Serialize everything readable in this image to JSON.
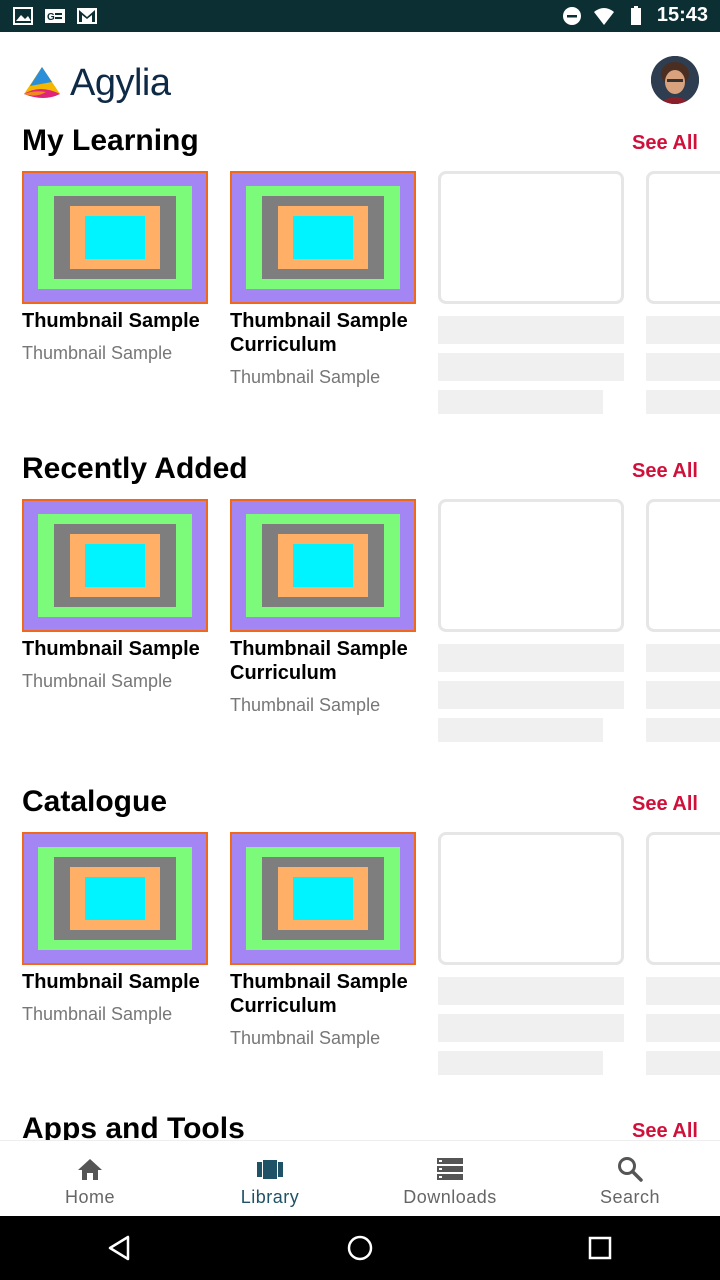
{
  "status_bar": {
    "time": "15:43",
    "left_icons": [
      "image-icon",
      "news-icon",
      "gmail-icon"
    ],
    "right_icons": [
      "do-not-disturb-icon",
      "wifi-icon",
      "battery-icon"
    ]
  },
  "header": {
    "app_name": "Agylia"
  },
  "sections": [
    {
      "title": "My Learning",
      "see_all": "See All",
      "cards": [
        {
          "title": "Thumbnail Sample",
          "subtitle": "Thumbnail Sample"
        },
        {
          "title": "Thumbnail Sample Curriculum",
          "subtitle": "Thumbnail Sample"
        }
      ]
    },
    {
      "title": "Recently Added",
      "see_all": "See All",
      "cards": [
        {
          "title": "Thumbnail Sample",
          "subtitle": "Thumbnail Sample"
        },
        {
          "title": "Thumbnail Sample Curriculum",
          "subtitle": "Thumbnail Sample"
        }
      ]
    },
    {
      "title": "Catalogue",
      "see_all": "See All",
      "cards": [
        {
          "title": "Thumbnail Sample",
          "subtitle": "Thumbnail Sample"
        },
        {
          "title": "Thumbnail Sample Curriculum",
          "subtitle": "Thumbnail Sample"
        }
      ]
    },
    {
      "title": "Apps and Tools",
      "see_all": "See All"
    }
  ],
  "bottom_nav": {
    "active": "Library",
    "items": [
      {
        "label": "Home",
        "icon": "home-icon"
      },
      {
        "label": "Library",
        "icon": "library-icon"
      },
      {
        "label": "Downloads",
        "icon": "downloads-icon"
      },
      {
        "label": "Search",
        "icon": "search-icon"
      }
    ]
  },
  "colors": {
    "status_bar": "#0b2f33",
    "accent_see_all": "#d0103a",
    "nav_active": "#1f5266",
    "logo_text": "#0e2a47"
  }
}
